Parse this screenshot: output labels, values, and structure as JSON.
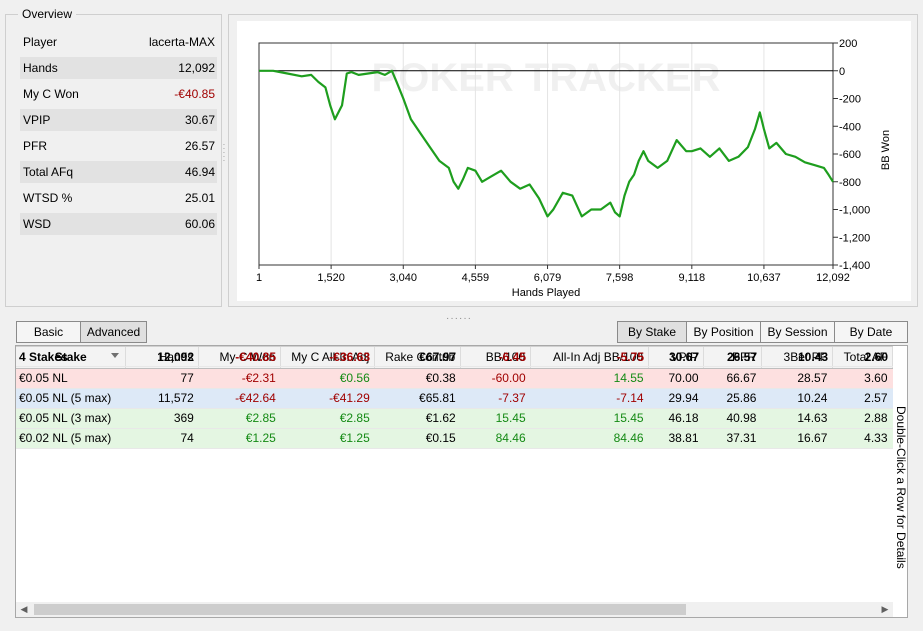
{
  "overview": {
    "title": "Overview",
    "rows": [
      {
        "label": "Player",
        "value": "lacerta-MAX",
        "negative": false
      },
      {
        "label": "Hands",
        "value": "12,092",
        "negative": false
      },
      {
        "label": "My C Won",
        "value": "-€40.85",
        "negative": true
      },
      {
        "label": "VPIP",
        "value": "30.67",
        "negative": false
      },
      {
        "label": "PFR",
        "value": "26.57",
        "negative": false
      },
      {
        "label": "Total AFq",
        "value": "46.94",
        "negative": false
      },
      {
        "label": "WTSD %",
        "value": "25.01",
        "negative": false
      },
      {
        "label": "WSD",
        "value": "60.06",
        "negative": false
      }
    ]
  },
  "chart_data": {
    "type": "line",
    "title": "",
    "watermark": "POKER TRACKER",
    "xlabel": "Hands Played",
    "ylabel": "BB Won",
    "xticks": [
      "1",
      "1,520",
      "3,040",
      "4,559",
      "6,079",
      "7,598",
      "9,118",
      "10,637",
      "12,092"
    ],
    "yticks": [
      "200",
      "0",
      "-200",
      "-400",
      "-600",
      "-800",
      "-1,000",
      "-1,200",
      "-1,400"
    ],
    "xlim": [
      1,
      12092
    ],
    "ylim": [
      -1400,
      200
    ],
    "color": "#1e9e1e",
    "series": [
      {
        "x": [
          1,
          300,
          600,
          900,
          1100,
          1250,
          1400,
          1500,
          1600,
          1750,
          1850,
          1950,
          2100,
          2300,
          2500,
          2650,
          2800,
          2900,
          3040,
          3200,
          3400,
          3600,
          3800,
          4000,
          4100,
          4200,
          4300,
          4400,
          4559,
          4700,
          4900,
          5100,
          5300,
          5500,
          5700,
          5900,
          6079,
          6200,
          6400,
          6600,
          6800,
          7000,
          7200,
          7400,
          7500,
          7598,
          7700,
          7800,
          7900,
          8000,
          8100,
          8200,
          8400,
          8600,
          8800,
          9000,
          9118,
          9300,
          9500,
          9700,
          9900,
          10100,
          10300,
          10450,
          10550,
          10637,
          10750,
          10900,
          11100,
          11300,
          11500,
          11700,
          11900,
          12000,
          12092
        ],
        "y": [
          0,
          0,
          -20,
          -40,
          -30,
          -80,
          -120,
          -250,
          -350,
          -250,
          -20,
          -10,
          -30,
          -20,
          -10,
          -30,
          0,
          -80,
          -200,
          -350,
          -450,
          -550,
          -650,
          -700,
          -800,
          -850,
          -780,
          -700,
          -720,
          -800,
          -760,
          -720,
          -800,
          -850,
          -820,
          -920,
          -1050,
          -1000,
          -880,
          -900,
          -1050,
          -1000,
          -1000,
          -950,
          -1020,
          -1050,
          -900,
          -800,
          -750,
          -650,
          -580,
          -650,
          -700,
          -650,
          -500,
          -580,
          -580,
          -560,
          -620,
          -560,
          -650,
          -620,
          -550,
          -420,
          -300,
          -420,
          -560,
          -520,
          -600,
          -620,
          -660,
          -680,
          -700,
          -750,
          -800
        ]
      }
    ]
  },
  "tabs_left": [
    {
      "label": "Basic",
      "active": false
    },
    {
      "label": "Advanced",
      "active": true
    }
  ],
  "tabs_right": [
    {
      "label": "By Stake",
      "active": true
    },
    {
      "label": "By Position",
      "active": false
    },
    {
      "label": "By Session",
      "active": false
    },
    {
      "label": "By Date",
      "active": false
    }
  ],
  "table": {
    "columns": [
      "Stake",
      "Hands",
      "My C Won",
      "My C All-In Adj",
      "Rake Contrib",
      "BB/100",
      "All-In Adj BB/100",
      "VPIP",
      "PFR",
      "3Bet PF",
      "Total AF"
    ],
    "rows": [
      [
        "€0.05 NL",
        "77",
        "-€2.31",
        "€0.56",
        "€0.38",
        "-60.00",
        "14.55",
        "70.00",
        "66.67",
        "28.57",
        "3.60"
      ],
      [
        "€0.05 NL (5 max)",
        "11,572",
        "-€42.64",
        "-€41.29",
        "€65.81",
        "-7.37",
        "-7.14",
        "29.94",
        "25.86",
        "10.24",
        "2.57"
      ],
      [
        "€0.05 NL (3 max)",
        "369",
        "€2.85",
        "€2.85",
        "€1.62",
        "15.45",
        "15.45",
        "46.18",
        "40.98",
        "14.63",
        "2.88"
      ],
      [
        "€0.02 NL (5 max)",
        "74",
        "€1.25",
        "€1.25",
        "€0.15",
        "84.46",
        "84.46",
        "38.81",
        "37.31",
        "16.67",
        "4.33"
      ]
    ],
    "totals": [
      "4 Stakes",
      "12,092",
      "-€40.85",
      "-€36.63",
      "€67.97",
      "-6.45",
      "-5.75",
      "30.67",
      "26.57",
      "10.43",
      "2.60"
    ],
    "side_hint": "Double-Click a Row for Details"
  },
  "colors": {
    "negative": "#a00000",
    "positive": "#148a14",
    "line": "#1e9e1e"
  }
}
